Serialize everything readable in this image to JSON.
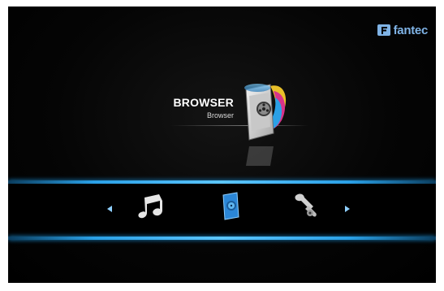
{
  "brand": {
    "name": "fantec"
  },
  "hero": {
    "title": "BROWSER",
    "subtitle": "Browser"
  },
  "menu": {
    "items": [
      {
        "icon": "music-note-icon"
      },
      {
        "icon": "browser-icon",
        "selected": true
      },
      {
        "icon": "wrench-tools-icon"
      }
    ]
  },
  "colors": {
    "accent": "#2aa0e6",
    "background": "#000000",
    "brand": "#7fb3e6"
  }
}
